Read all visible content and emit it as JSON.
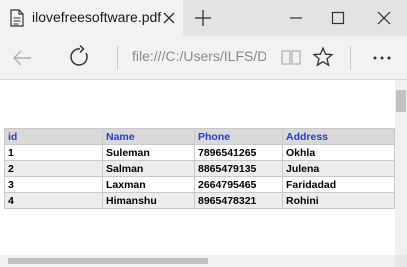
{
  "tab": {
    "title": "ilovefreesoftware.pdf"
  },
  "address": {
    "url": "file:///C:/Users/ILFS/De"
  },
  "icons": {
    "tab": "pdf-document-icon",
    "close": "close-icon",
    "new_tab": "plus-icon",
    "minimize": "minimize-icon",
    "maximize": "maximize-icon",
    "window_close": "close-icon",
    "back": "back-arrow-icon",
    "refresh": "refresh-icon",
    "reading_view": "book-icon",
    "favorite": "star-icon",
    "more": "more-icon"
  },
  "colors": {
    "header_text": "#1f3fd1",
    "header_bg": "#d9d9d9",
    "stripe": "#ececec"
  },
  "table": {
    "headers": [
      "id",
      "Name",
      "Phone",
      "Address"
    ],
    "rows": [
      [
        "1",
        "Suleman",
        "7896541265",
        "Okhla"
      ],
      [
        "2",
        "Salman",
        "8865479135",
        "Julena"
      ],
      [
        "3",
        "Laxman",
        "2664795465",
        "Faridadad"
      ],
      [
        "4",
        "Himanshu",
        "8965478321",
        "Rohini"
      ]
    ]
  }
}
